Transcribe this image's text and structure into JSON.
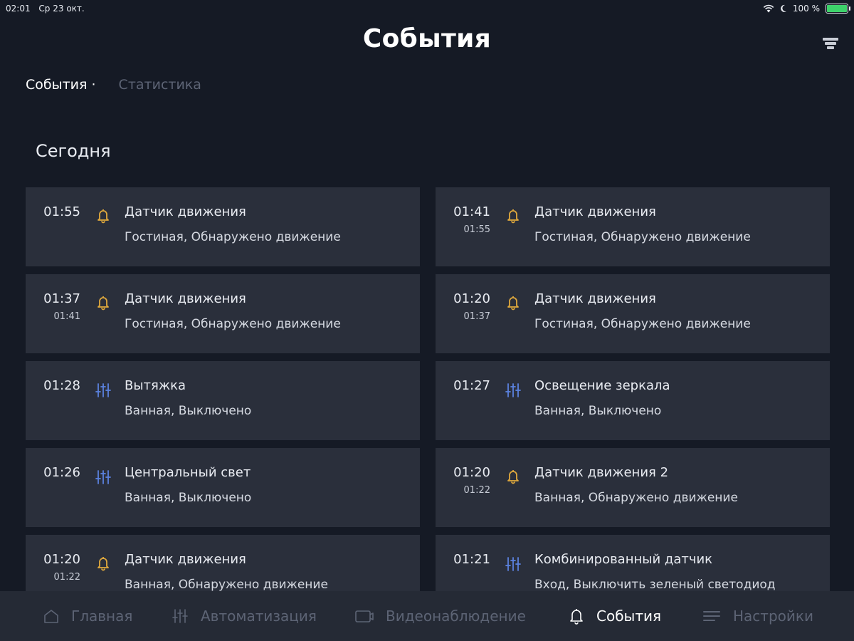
{
  "status_bar": {
    "time": "02:01",
    "date": "Ср 23 окт.",
    "battery": "100 %"
  },
  "header": {
    "title": "События"
  },
  "tabs": [
    {
      "label": "События ·",
      "active": true
    },
    {
      "label": "Статистика",
      "active": false
    }
  ],
  "section": {
    "title": "Сегодня"
  },
  "events": [
    {
      "time": "01:55",
      "end": "",
      "icon": "bell-icon",
      "title": "Датчик движения",
      "desc": "Гостиная, Обнаружено движение"
    },
    {
      "time": "01:41",
      "end": "01:55",
      "icon": "bell-icon",
      "title": "Датчик движения",
      "desc": "Гостиная, Обнаружено движение"
    },
    {
      "time": "01:37",
      "end": "01:41",
      "icon": "bell-icon",
      "title": "Датчик движения",
      "desc": "Гостиная, Обнаружено движение"
    },
    {
      "time": "01:20",
      "end": "01:37",
      "icon": "bell-icon",
      "title": "Датчик движения",
      "desc": "Гостиная, Обнаружено движение"
    },
    {
      "time": "01:28",
      "end": "",
      "icon": "sliders-icon",
      "title": "Вытяжка",
      "desc": "Ванная, Выключено"
    },
    {
      "time": "01:27",
      "end": "",
      "icon": "sliders-icon",
      "title": "Освещение зеркала",
      "desc": "Ванная, Выключено"
    },
    {
      "time": "01:26",
      "end": "",
      "icon": "sliders-icon",
      "title": "Центральный свет",
      "desc": "Ванная, Выключено"
    },
    {
      "time": "01:20",
      "end": "01:22",
      "icon": "bell-icon",
      "title": "Датчик движения 2",
      "desc": "Ванная, Обнаружено движение"
    },
    {
      "time": "01:20",
      "end": "01:22",
      "icon": "bell-icon",
      "title": "Датчик движения",
      "desc": "Ванная, Обнаружено движение"
    },
    {
      "time": "01:21",
      "end": "",
      "icon": "sliders-icon",
      "title": "Комбинированный датчик",
      "desc": "Вход, Выключить зеленый светодиод"
    }
  ],
  "nav": [
    {
      "label": "Главная",
      "icon": "home-icon",
      "active": false
    },
    {
      "label": "Автоматизация",
      "icon": "sliders-icon",
      "active": false
    },
    {
      "label": "Видеонаблюдение",
      "icon": "camera-icon",
      "active": false
    },
    {
      "label": "События",
      "icon": "bell-icon",
      "active": true
    },
    {
      "label": "Настройки",
      "icon": "menu-icon",
      "active": false
    }
  ],
  "colors": {
    "background": "#151a25",
    "card": "#2a2f3b",
    "nav_bar": "#252a35",
    "bell_accent": "#e0a93d",
    "sliders_accent": "#5b82e0",
    "inactive_text": "#5d6475",
    "battery": "#3dd26b"
  }
}
